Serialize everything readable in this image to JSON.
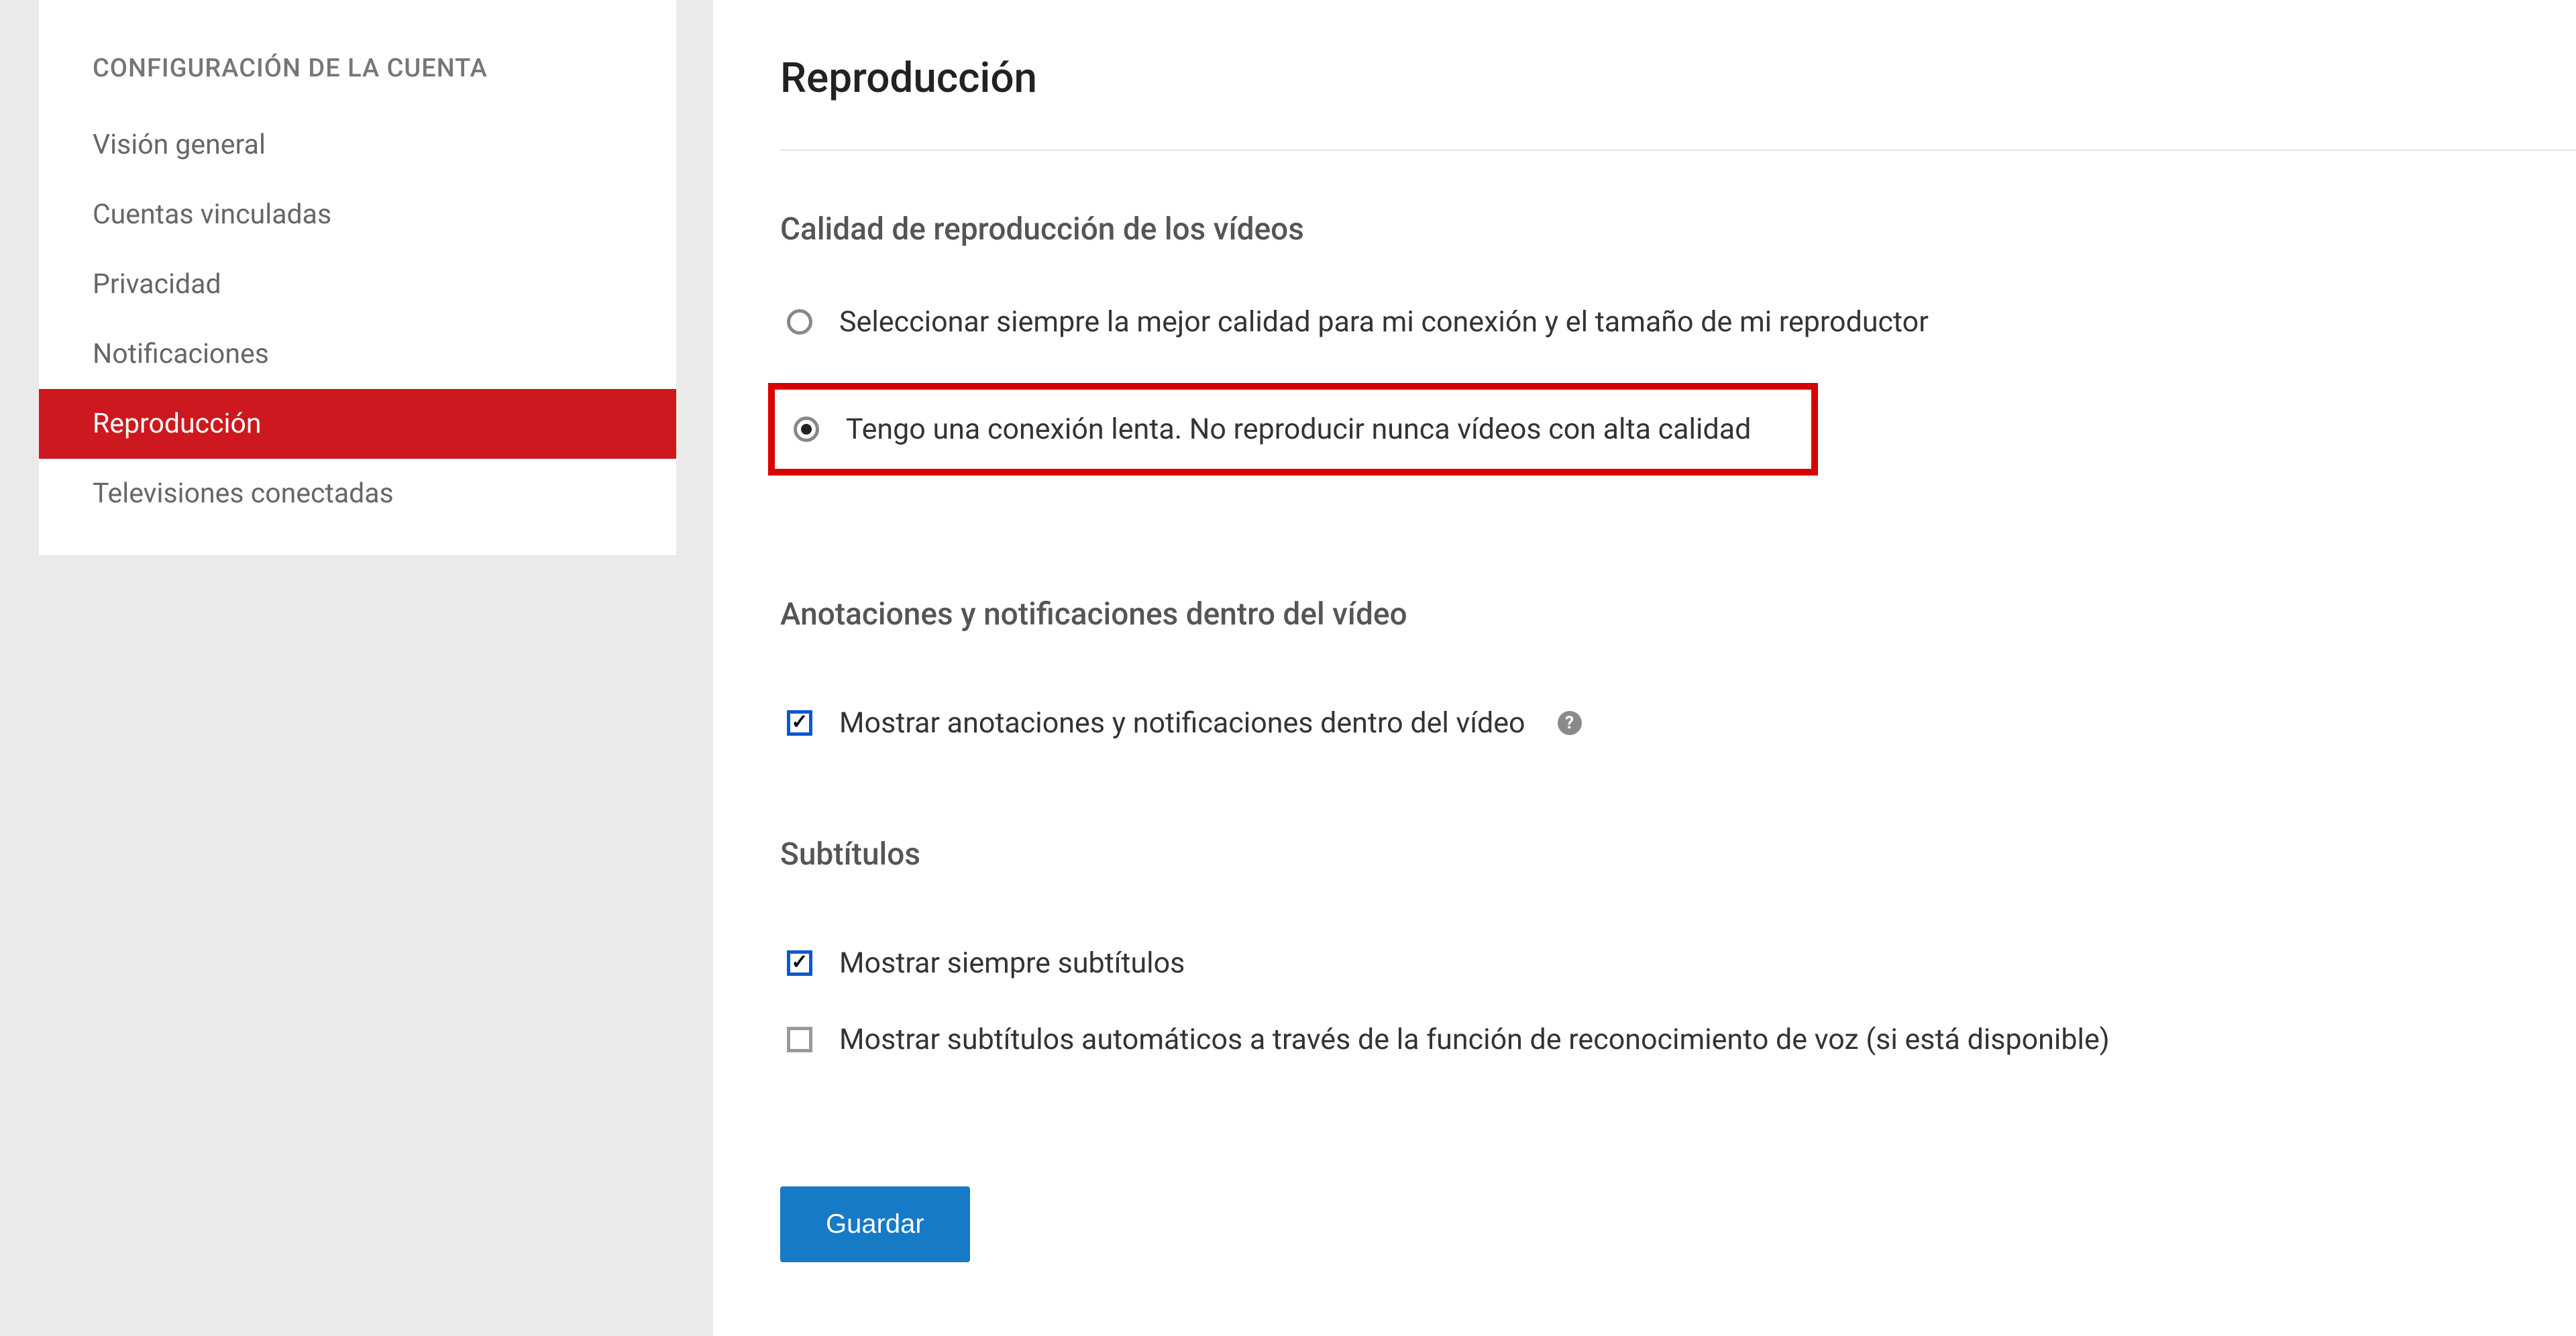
{
  "sidebar": {
    "header": "CONFIGURACIÓN DE LA CUENTA",
    "items": [
      {
        "label": "Visión general",
        "active": false
      },
      {
        "label": "Cuentas vinculadas",
        "active": false
      },
      {
        "label": "Privacidad",
        "active": false
      },
      {
        "label": "Notificaciones",
        "active": false
      },
      {
        "label": "Reproducción",
        "active": true
      },
      {
        "label": "Televisiones conectadas",
        "active": false
      }
    ]
  },
  "main": {
    "title": "Reproducción",
    "quality": {
      "heading": "Calidad de reproducción de los vídeos",
      "options": [
        {
          "label": "Seleccionar siempre la mejor calidad para mi conexión y el tamaño de mi reproductor",
          "selected": false
        },
        {
          "label": "Tengo una conexión lenta. No reproducir nunca vídeos con alta calidad",
          "selected": true,
          "highlighted": true
        }
      ]
    },
    "annotations": {
      "heading": "Anotaciones y notificaciones dentro del vídeo",
      "checkbox": {
        "label": "Mostrar anotaciones y notificaciones dentro del vídeo",
        "checked": true
      }
    },
    "subtitles": {
      "heading": "Subtítulos",
      "checkboxes": [
        {
          "label": "Mostrar siempre subtítulos",
          "checked": true
        },
        {
          "label": "Mostrar subtítulos automáticos a través de la función de reconocimiento de voz (si está disponible)",
          "checked": false
        }
      ]
    },
    "save_label": "Guardar"
  }
}
